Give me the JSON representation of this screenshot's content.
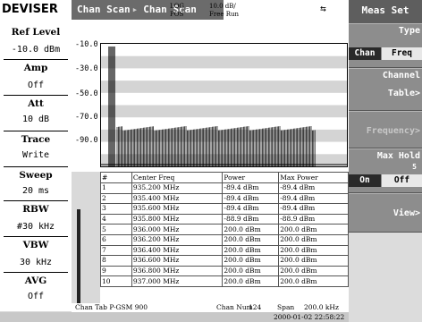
{
  "header": {
    "logo": "DEVISER",
    "mode_tabs": [
      "Chan Scan",
      "Chan Scan"
    ],
    "detector": "LOG",
    "scale": "10.0 dB/",
    "pos_label": "POS",
    "trigger": "Free Run",
    "usb_icon": "usb-icon"
  },
  "left_panel": {
    "ref_level_label": "Ref Level",
    "ref_level_value": "-10.0 dBm",
    "amp_label": "Amp",
    "amp_value": "Off",
    "att_label": "Att",
    "att_value": "10 dB",
    "trace_label": "Trace",
    "trace_value": "Write",
    "sweep_label": "Sweep",
    "sweep_value": "20 ms",
    "rbw_label": "RBW",
    "rbw_value": "#30 kHz",
    "vbw_label": "VBW",
    "vbw_value": "30 kHz",
    "avg_label": "AVG",
    "avg_value": "Off"
  },
  "plot": {
    "y_ticks": [
      "-10.0",
      "-30.0",
      "-50.0",
      "-70.0",
      "-90.0"
    ]
  },
  "table": {
    "headers": [
      "#",
      "Center Freq",
      "Power",
      "Max Power"
    ],
    "rows": [
      [
        "1",
        "935.200 MHz",
        "-89.4 dBm",
        "-89.4 dBm"
      ],
      [
        "2",
        "935.400 MHz",
        "-89.4 dBm",
        "-89.4 dBm"
      ],
      [
        "3",
        "935.600 MHz",
        "-89.4 dBm",
        "-89.4 dBm"
      ],
      [
        "4",
        "935.800 MHz",
        "-88.9 dBm",
        "-88.9 dBm"
      ],
      [
        "5",
        "936.000 MHz",
        "200.0 dBm",
        "200.0 dBm"
      ],
      [
        "6",
        "936.200 MHz",
        "200.0 dBm",
        "200.0 dBm"
      ],
      [
        "7",
        "936.400 MHz",
        "200.0 dBm",
        "200.0 dBm"
      ],
      [
        "8",
        "936.600 MHz",
        "200.0 dBm",
        "200.0 dBm"
      ],
      [
        "9",
        "936.800 MHz",
        "200.0 dBm",
        "200.0 dBm"
      ],
      [
        "10",
        "937.000 MHz",
        "200.0 dBm",
        "200.0 dBm"
      ]
    ]
  },
  "bottom": {
    "chan_tab": "Chan Tab P-GSM 900",
    "chan_num_label": "Chan Num",
    "chan_num": "124",
    "span_label": "Span",
    "span": "200.0 kHz",
    "datetime": "2000-01-02 22:58:22"
  },
  "menu": {
    "title": "Meas Set",
    "type_label": "Type",
    "type_opt_a": "Chan",
    "type_opt_b": "Freq",
    "channel_table_label": "Channel",
    "channel_table_sub": "Table>",
    "frequency_label": "Frequency>",
    "max_hold_label": "Max Hold",
    "max_hold_count": "5",
    "max_hold_on": "On",
    "max_hold_off": "Off",
    "view_label": "View>"
  },
  "colors": {
    "menu_button": "#8d8d8d",
    "menu_title": "#5e5e5e",
    "selected": "#2a2a2a",
    "grid_band": "#d4d4d4"
  }
}
